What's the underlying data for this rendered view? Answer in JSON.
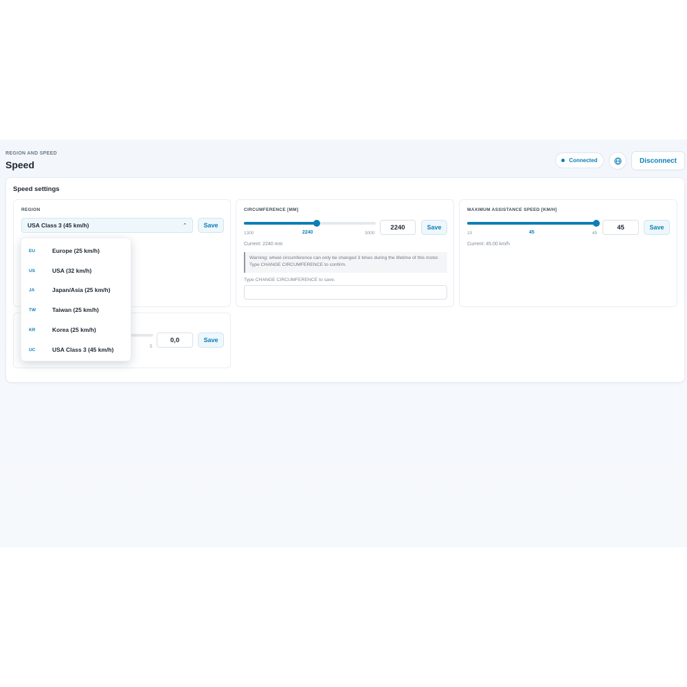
{
  "header": {
    "eyebrow": "REGION AND SPEED",
    "title": "Speed",
    "status": "Connected",
    "globe_icon": "globe-icon",
    "disconnect_label": "Disconnect"
  },
  "panel": {
    "title": "Speed settings"
  },
  "region": {
    "label": "REGION",
    "selected": "USA Class 3 (45 km/h)",
    "save_label": "Save",
    "options": [
      {
        "code": "EU",
        "label": "Europe (25 km/h)"
      },
      {
        "code": "US",
        "label": "USA (32 km/h)"
      },
      {
        "code": "JA",
        "label": "Japan/Asia (25 km/h)"
      },
      {
        "code": "TW",
        "label": "Taiwan (25 km/h)"
      },
      {
        "code": "KR",
        "label": "Korea (25 km/h)"
      },
      {
        "code": "UC",
        "label": "USA Class 3 (45 km/h)"
      }
    ]
  },
  "circumference": {
    "label": "CIRCUMFERENCE [MM]",
    "min": 1300,
    "max": 3000,
    "value": 2240,
    "min_label": "1300",
    "max_label": "3000",
    "value_label": "2240",
    "input_value": "2240",
    "save_label": "Save",
    "current": "Current: 2240 mm",
    "warning": "Warning: wheel circumference can only be changed 3 times during the lifetime of this motor. Type CHANGE CIRCUMFERENCE to confirm.",
    "hint": "Type CHANGE CIRCUMFERENCE to save."
  },
  "max_speed": {
    "label": "MAXIMUM ASSISTANCE SPEED [KM/H]",
    "min": 10,
    "max": 45,
    "value": 45,
    "min_label": "10",
    "max_label": "45",
    "value_label": "45",
    "input_value": "45",
    "save_label": "Save",
    "current": "Current: 45.00 km/h"
  },
  "fourth": {
    "max_label": "5",
    "input_value": "0,0",
    "save_label": "Save"
  },
  "colors": {
    "accent": "#0c7fb8",
    "background": "#f3f7fb"
  }
}
